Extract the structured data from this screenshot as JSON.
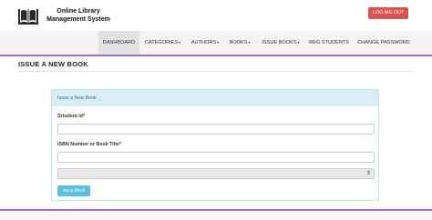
{
  "header": {
    "logo_icon": "book-icon",
    "title_line1": "Online Library",
    "title_line2": "Management System",
    "logout_label": "LOG ME OUT"
  },
  "nav": {
    "items": [
      {
        "label": "DASHBOARD",
        "dropdown": false
      },
      {
        "label": "CATEGORIES",
        "dropdown": true
      },
      {
        "label": "AUTHORS",
        "dropdown": true
      },
      {
        "label": "BOOKS",
        "dropdown": true
      },
      {
        "label": "ISSUE BOOKS",
        "dropdown": true
      },
      {
        "label": "REG STUDENTS",
        "dropdown": false
      },
      {
        "label": "CHANGE PASSWORD",
        "dropdown": false
      }
    ],
    "caret": "▾"
  },
  "page": {
    "title": "ISSUE A NEW BOOK"
  },
  "form": {
    "heading": "Issue a New Book",
    "student_label": "Srtudent id",
    "student_value": "",
    "book_label": "ISBN Number or Book Title",
    "book_value": "",
    "select_value": "",
    "required_mark": "*",
    "submit_label": "Issue Book"
  },
  "colors": {
    "accent": "#a36bd6",
    "logout": "#d9534f",
    "panel_heading": "#d9edf7",
    "submit": "#5bc0de"
  }
}
